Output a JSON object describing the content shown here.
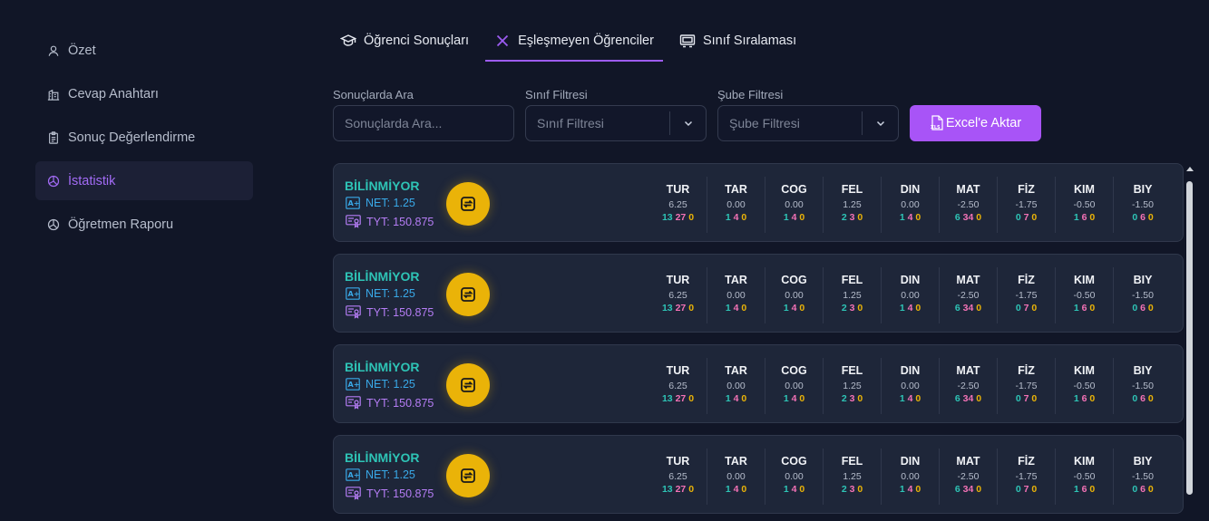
{
  "sidebar": {
    "items": [
      {
        "label": "Özet",
        "icon": "user-icon",
        "active": false
      },
      {
        "label": "Cevap Anahtarı",
        "icon": "building-icon",
        "active": false
      },
      {
        "label": "Sonuç Değerlendirme",
        "icon": "clipboard-icon",
        "active": false
      },
      {
        "label": "İstatistik",
        "icon": "pie-chart-icon",
        "active": true
      },
      {
        "label": "Öğretmen Raporu",
        "icon": "pie-chart-icon",
        "active": false
      }
    ]
  },
  "tabs": [
    {
      "label": "Öğrenci Sonuçları",
      "icon": "graduation-cap-icon",
      "active": false
    },
    {
      "label": "Eşleşmeyen Öğrenciler",
      "icon": "x-icon",
      "active": true
    },
    {
      "label": "Sınıf Sıralaması",
      "icon": "classroom-board-icon",
      "active": false
    }
  ],
  "filters": {
    "search": {
      "label": "Sonuçlarda Ara",
      "placeholder": "Sonuçlarda Ara..."
    },
    "class": {
      "label": "Sınıf Filtresi",
      "placeholder": "Sınıf Filtresi"
    },
    "branch": {
      "label": "Şube Filtresi",
      "placeholder": "Şube Filtresi"
    }
  },
  "excel_button": {
    "label": "Excel'e Aktar",
    "icon": "xls-file-icon"
  },
  "colors": {
    "accent": "#a854f7",
    "teal": "#2ec4b6",
    "pink": "#f472b6",
    "yellow": "#eab308",
    "background": "#111627",
    "card": "#1e2639"
  },
  "cards": [
    {
      "name": "BİLİNMİYOR",
      "net": "NET: 1.25",
      "tyt": "TYT: 150.875",
      "subjects": [
        {
          "name": "TUR",
          "net": "6.25",
          "t": "13",
          "f": "27",
          "e": "0"
        },
        {
          "name": "TAR",
          "net": "0.00",
          "t": "1",
          "f": "4",
          "e": "0"
        },
        {
          "name": "COG",
          "net": "0.00",
          "t": "1",
          "f": "4",
          "e": "0"
        },
        {
          "name": "FEL",
          "net": "1.25",
          "t": "2",
          "f": "3",
          "e": "0"
        },
        {
          "name": "DIN",
          "net": "0.00",
          "t": "1",
          "f": "4",
          "e": "0"
        },
        {
          "name": "MAT",
          "net": "-2.50",
          "t": "6",
          "f": "34",
          "e": "0"
        },
        {
          "name": "FİZ",
          "net": "-1.75",
          "t": "0",
          "f": "7",
          "e": "0"
        },
        {
          "name": "KIM",
          "net": "-0.50",
          "t": "1",
          "f": "6",
          "e": "0"
        },
        {
          "name": "BIY",
          "net": "-1.50",
          "t": "0",
          "f": "6",
          "e": "0"
        }
      ]
    },
    {
      "name": "BİLİNMİYOR",
      "net": "NET: 1.25",
      "tyt": "TYT: 150.875",
      "subjects": [
        {
          "name": "TUR",
          "net": "6.25",
          "t": "13",
          "f": "27",
          "e": "0"
        },
        {
          "name": "TAR",
          "net": "0.00",
          "t": "1",
          "f": "4",
          "e": "0"
        },
        {
          "name": "COG",
          "net": "0.00",
          "t": "1",
          "f": "4",
          "e": "0"
        },
        {
          "name": "FEL",
          "net": "1.25",
          "t": "2",
          "f": "3",
          "e": "0"
        },
        {
          "name": "DIN",
          "net": "0.00",
          "t": "1",
          "f": "4",
          "e": "0"
        },
        {
          "name": "MAT",
          "net": "-2.50",
          "t": "6",
          "f": "34",
          "e": "0"
        },
        {
          "name": "FİZ",
          "net": "-1.75",
          "t": "0",
          "f": "7",
          "e": "0"
        },
        {
          "name": "KIM",
          "net": "-0.50",
          "t": "1",
          "f": "6",
          "e": "0"
        },
        {
          "name": "BIY",
          "net": "-1.50",
          "t": "0",
          "f": "6",
          "e": "0"
        }
      ]
    },
    {
      "name": "BİLİNMİYOR",
      "net": "NET: 1.25",
      "tyt": "TYT: 150.875",
      "subjects": [
        {
          "name": "TUR",
          "net": "6.25",
          "t": "13",
          "f": "27",
          "e": "0"
        },
        {
          "name": "TAR",
          "net": "0.00",
          "t": "1",
          "f": "4",
          "e": "0"
        },
        {
          "name": "COG",
          "net": "0.00",
          "t": "1",
          "f": "4",
          "e": "0"
        },
        {
          "name": "FEL",
          "net": "1.25",
          "t": "2",
          "f": "3",
          "e": "0"
        },
        {
          "name": "DIN",
          "net": "0.00",
          "t": "1",
          "f": "4",
          "e": "0"
        },
        {
          "name": "MAT",
          "net": "-2.50",
          "t": "6",
          "f": "34",
          "e": "0"
        },
        {
          "name": "FİZ",
          "net": "-1.75",
          "t": "0",
          "f": "7",
          "e": "0"
        },
        {
          "name": "KIM",
          "net": "-0.50",
          "t": "1",
          "f": "6",
          "e": "0"
        },
        {
          "name": "BIY",
          "net": "-1.50",
          "t": "0",
          "f": "6",
          "e": "0"
        }
      ]
    },
    {
      "name": "BİLİNMİYOR",
      "net": "NET: 1.25",
      "tyt": "TYT: 150.875",
      "subjects": [
        {
          "name": "TUR",
          "net": "6.25",
          "t": "13",
          "f": "27",
          "e": "0"
        },
        {
          "name": "TAR",
          "net": "0.00",
          "t": "1",
          "f": "4",
          "e": "0"
        },
        {
          "name": "COG",
          "net": "0.00",
          "t": "1",
          "f": "4",
          "e": "0"
        },
        {
          "name": "FEL",
          "net": "1.25",
          "t": "2",
          "f": "3",
          "e": "0"
        },
        {
          "name": "DIN",
          "net": "0.00",
          "t": "1",
          "f": "4",
          "e": "0"
        },
        {
          "name": "MAT",
          "net": "-2.50",
          "t": "6",
          "f": "34",
          "e": "0"
        },
        {
          "name": "FİZ",
          "net": "-1.75",
          "t": "0",
          "f": "7",
          "e": "0"
        },
        {
          "name": "KIM",
          "net": "-0.50",
          "t": "1",
          "f": "6",
          "e": "0"
        },
        {
          "name": "BIY",
          "net": "-1.50",
          "t": "0",
          "f": "6",
          "e": "0"
        }
      ]
    }
  ]
}
